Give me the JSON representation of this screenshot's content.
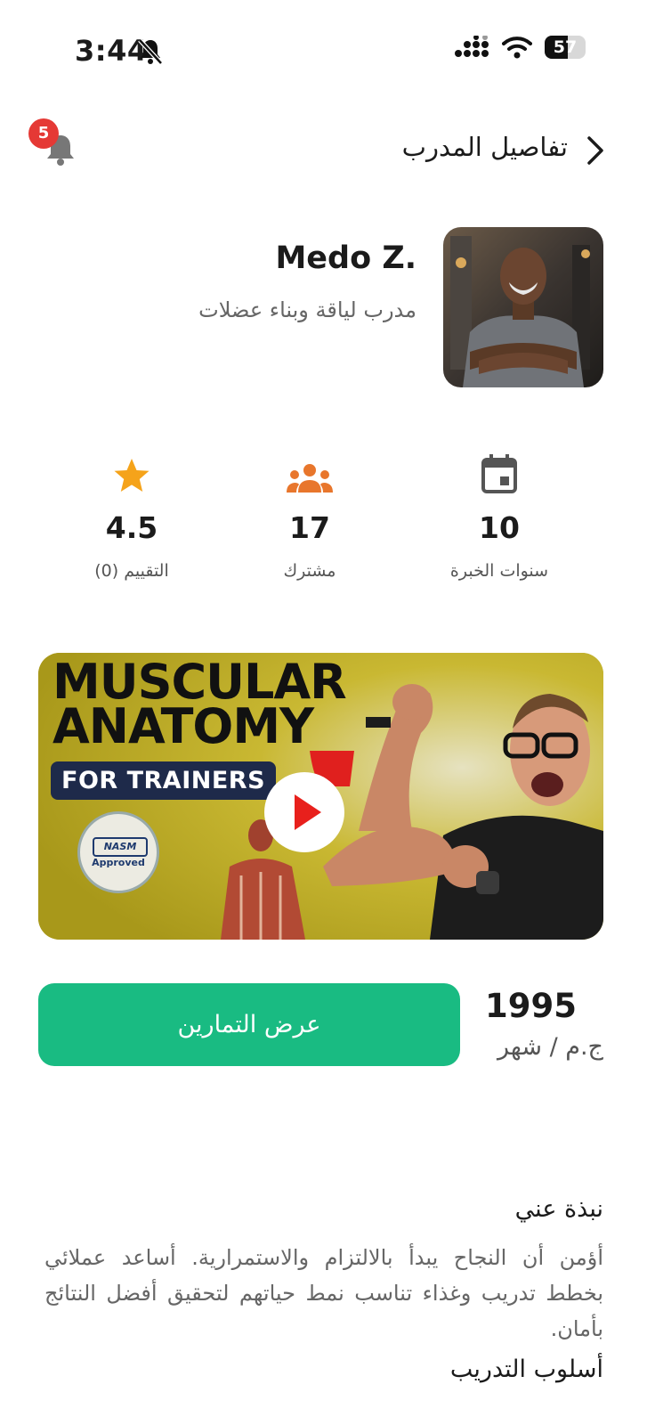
{
  "status_bar": {
    "time": "3:44",
    "battery": "57",
    "battery_level": 0.57,
    "icons": [
      "bell-slash-icon",
      "cellular-signal-icon",
      "wifi-icon",
      "battery-icon"
    ]
  },
  "header": {
    "title": "تفاصيل المدرب",
    "back_icon": "chevron-right-icon",
    "notification_icon": "bell-icon",
    "notification_count": "5"
  },
  "trainer": {
    "name": "Medo Z.",
    "subtitle": "مدرب لياقة وبناء عضلات",
    "photo": "trainer-photo"
  },
  "stats": [
    {
      "icon": "calendar-icon",
      "value": "10",
      "label": "سنوات الخبرة"
    },
    {
      "icon": "group-icon",
      "value": "17",
      "label": "مشترك"
    },
    {
      "icon": "star-icon",
      "value": "4.5",
      "label": "التقييم (0)"
    }
  ],
  "video": {
    "title_line1": "MUSCULAR",
    "title_line2": "ANATOMY",
    "badge": "FOR TRAINERS",
    "seal_text": "NASM",
    "seal_sub": "Approved",
    "play_icon": "play-icon"
  },
  "pricing": {
    "price": "1995",
    "unit": "ج.م / شهر",
    "button_label": "عرض التمارين"
  },
  "about": {
    "title": "نبذة عني",
    "text": "أؤمن أن النجاح يبدأ بالالتزام والاستمرارية. أساعد عملائي بخطط تدريب وغذاء تناسب نمط حياتهم لتحقيق أفضل النتائج بأمان."
  },
  "training_style": {
    "title": "أسلوب التدريب"
  },
  "colors": {
    "accent_green": "#19bb82",
    "badge_red": "#e53935",
    "star_orange": "#f5a31a",
    "group_orange": "#e8762c"
  }
}
